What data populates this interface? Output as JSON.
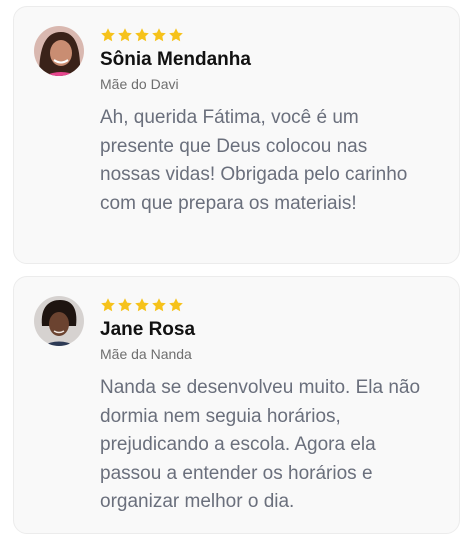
{
  "theme": {
    "star_color": "#f6c21b",
    "card_background": "#f9f9f9",
    "name_color": "#111111",
    "text_color": "#6a6f7c"
  },
  "testimonials": [
    {
      "rating": 5,
      "name": "Sônia Mendanha",
      "relation": "Mãe do Davi",
      "text": "Ah, querida Fátima, você é um presente que Deus colocou nas nossas vidas! Obrigada pelo carinho com que prepara os materiais!"
    },
    {
      "rating": 5,
      "name": "Jane Rosa",
      "relation": "Mãe da Nanda",
      "text": "Nanda se desenvolveu muito. Ela não dormia nem seguia horários, prejudicando a escola. Agora ela passou a entender os horários e organizar melhor o dia."
    }
  ]
}
